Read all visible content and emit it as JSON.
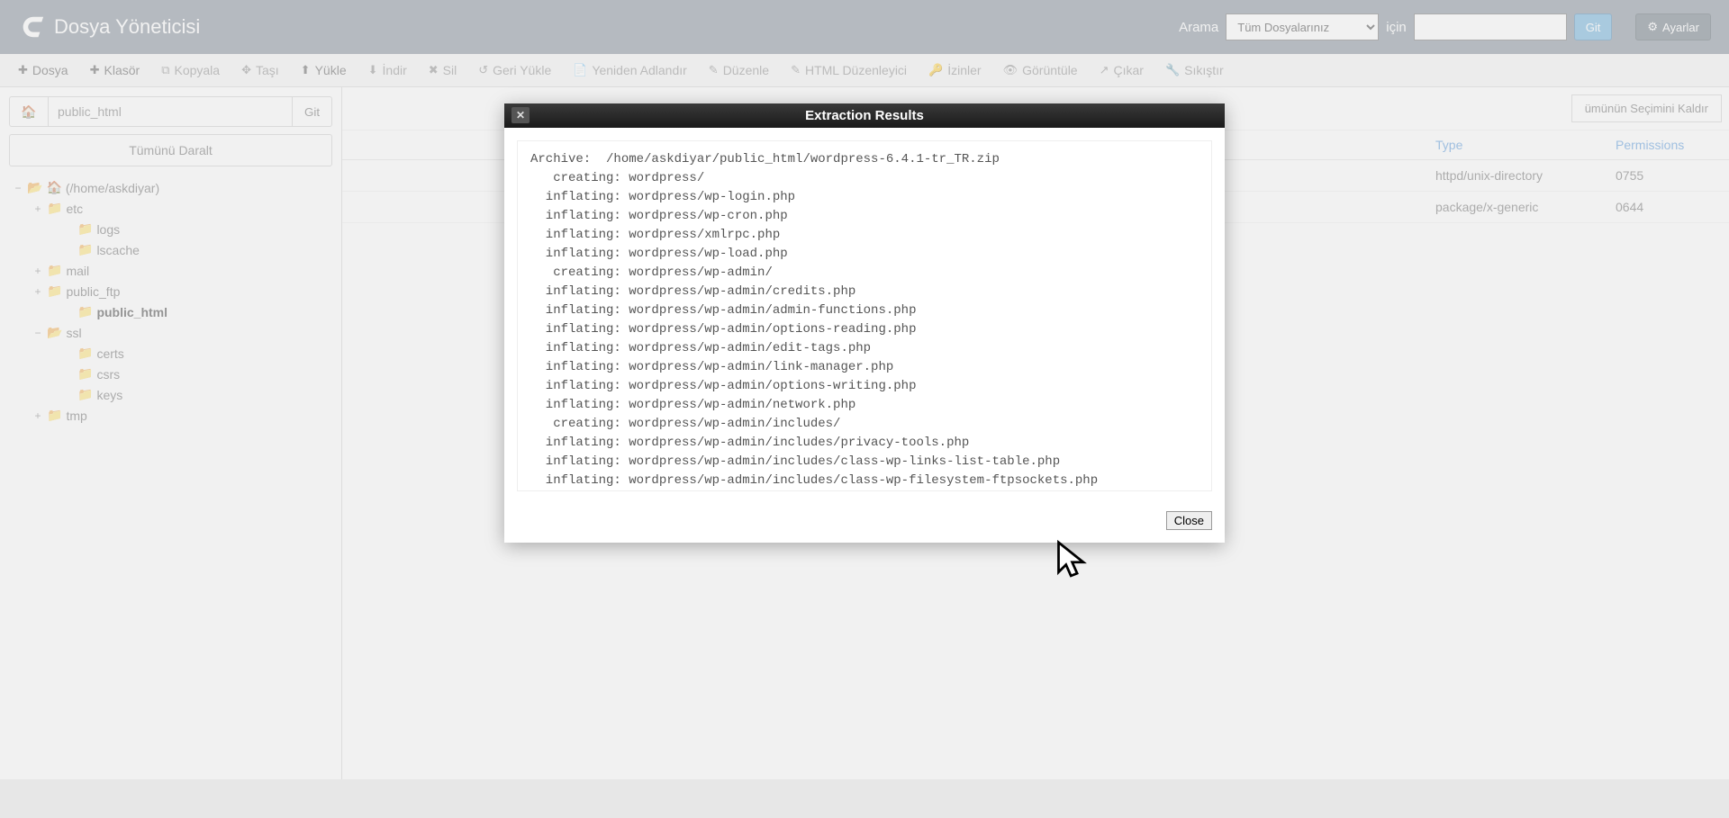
{
  "header": {
    "app_title": "Dosya Yöneticisi",
    "search_label": "Arama",
    "search_scope": "Tüm Dosyalarınız",
    "for_label": "için",
    "go_label": "Git",
    "settings_label": "Ayarlar"
  },
  "toolbar": {
    "file": "Dosya",
    "folder": "Klasör",
    "copy": "Kopyala",
    "move": "Taşı",
    "upload": "Yükle",
    "download": "İndir",
    "delete": "Sil",
    "restore": "Geri Yükle",
    "rename": "Yeniden Adlandır",
    "edit": "Düzenle",
    "html_edit": "HTML Düzenleyici",
    "permissions": "İzinler",
    "view": "Görüntüle",
    "extract": "Çıkar",
    "compress": "Sıkıştır"
  },
  "sidebar": {
    "path_value": "public_html",
    "go": "Git",
    "collapse_all": "Tümünü Daralt",
    "tree": [
      {
        "depth": 1,
        "exp": "−",
        "icon": "open",
        "home": true,
        "label": "(/home/askdiyar)"
      },
      {
        "depth": 2,
        "exp": "+",
        "icon": "closed",
        "label": "etc"
      },
      {
        "depth": 3,
        "exp": "",
        "icon": "closed",
        "label": "logs"
      },
      {
        "depth": 3,
        "exp": "",
        "icon": "closed",
        "label": "lscache"
      },
      {
        "depth": 2,
        "exp": "+",
        "icon": "closed",
        "label": "mail"
      },
      {
        "depth": 2,
        "exp": "+",
        "icon": "closed",
        "label": "public_ftp"
      },
      {
        "depth": 3,
        "exp": "",
        "icon": "closed",
        "label": "public_html",
        "selected": true
      },
      {
        "depth": 2,
        "exp": "−",
        "icon": "open",
        "label": "ssl"
      },
      {
        "depth": 3,
        "exp": "",
        "icon": "closed",
        "label": "certs"
      },
      {
        "depth": 3,
        "exp": "",
        "icon": "closed",
        "label": "csrs"
      },
      {
        "depth": 3,
        "exp": "",
        "icon": "closed",
        "label": "keys"
      },
      {
        "depth": 2,
        "exp": "+",
        "icon": "closed",
        "label": "tmp"
      }
    ]
  },
  "content": {
    "deselect_all": "ümünün Seçimini Kaldır",
    "col_type": "Type",
    "col_perm": "Permissions",
    "rows": [
      {
        "type": "httpd/unix-directory",
        "perm": "0755"
      },
      {
        "type": "package/x-generic",
        "perm": "0644"
      }
    ]
  },
  "modal": {
    "title": "Extraction Results",
    "close": "Close",
    "output": "Archive:  /home/askdiyar/public_html/wordpress-6.4.1-tr_TR.zip\n   creating: wordpress/\n  inflating: wordpress/wp-login.php\n  inflating: wordpress/wp-cron.php\n  inflating: wordpress/xmlrpc.php\n  inflating: wordpress/wp-load.php\n   creating: wordpress/wp-admin/\n  inflating: wordpress/wp-admin/credits.php\n  inflating: wordpress/wp-admin/admin-functions.php\n  inflating: wordpress/wp-admin/options-reading.php\n  inflating: wordpress/wp-admin/edit-tags.php\n  inflating: wordpress/wp-admin/link-manager.php\n  inflating: wordpress/wp-admin/options-writing.php\n  inflating: wordpress/wp-admin/network.php\n   creating: wordpress/wp-admin/includes/\n  inflating: wordpress/wp-admin/includes/privacy-tools.php\n  inflating: wordpress/wp-admin/includes/class-wp-links-list-table.php\n  inflating: wordpress/wp-admin/includes/class-wp-filesystem-ftpsockets.php\n"
  }
}
